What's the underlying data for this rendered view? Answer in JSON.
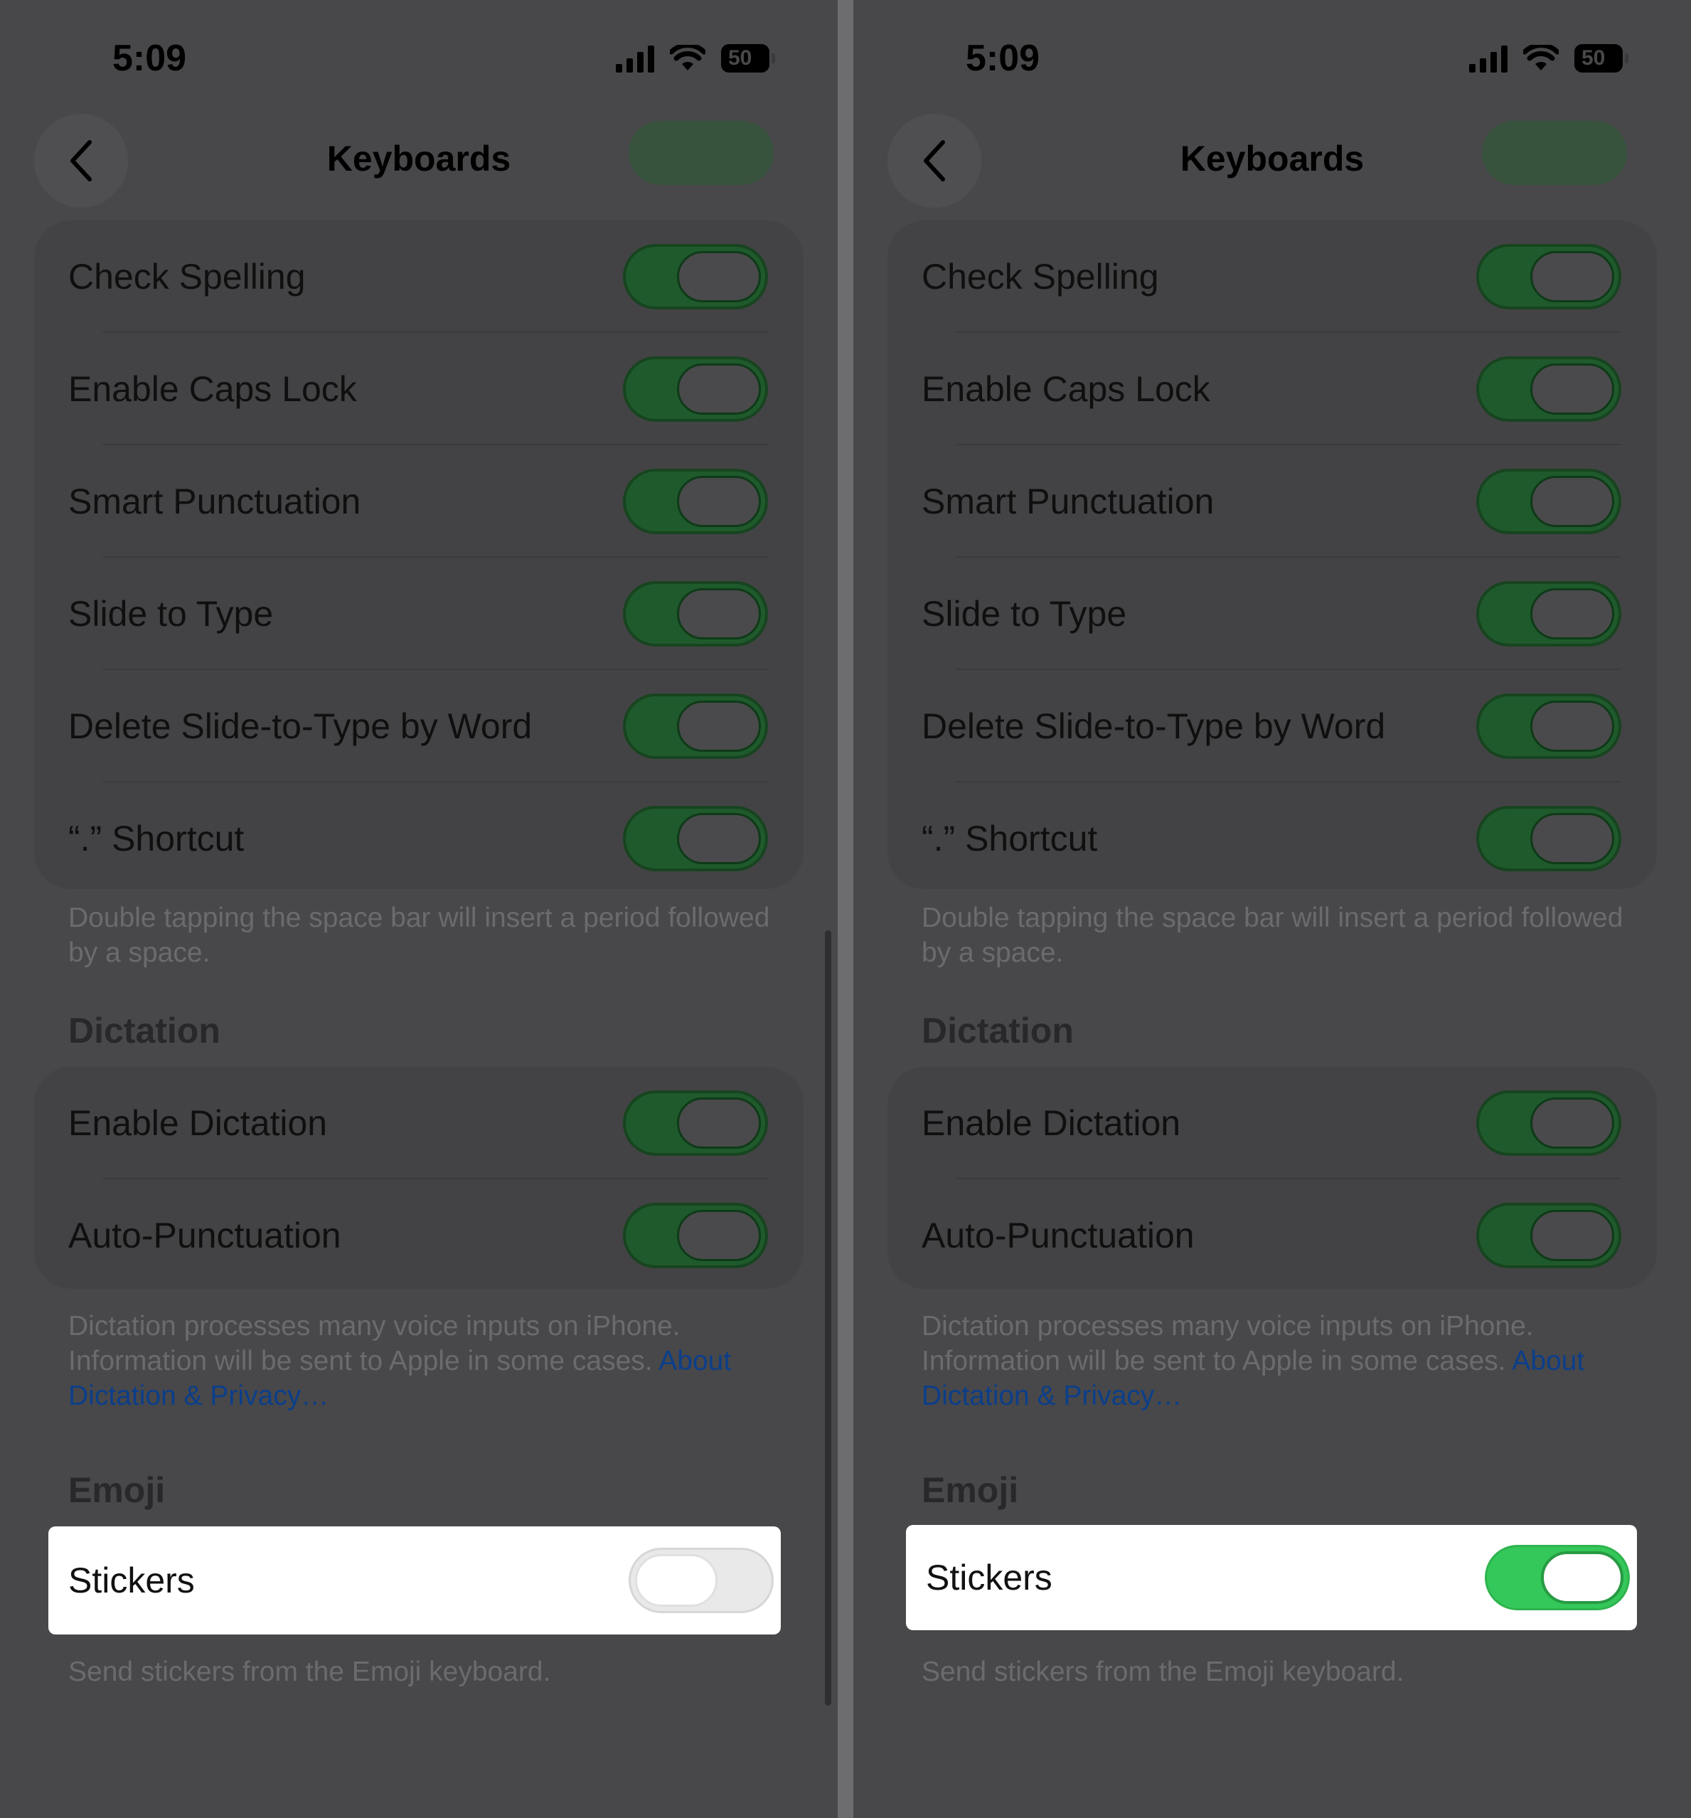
{
  "panels": [
    {
      "status": {
        "time": "5:09",
        "battery": "50"
      },
      "nav": {
        "title": "Keyboards"
      },
      "rows": [
        {
          "label": "Check Spelling",
          "on": true
        },
        {
          "label": "Enable Caps Lock",
          "on": true
        },
        {
          "label": "Smart Punctuation",
          "on": true
        },
        {
          "label": "Slide to Type",
          "on": true
        },
        {
          "label": "Delete Slide-to-Type by Word",
          "on": true
        },
        {
          "label": "“.” Shortcut",
          "on": true
        }
      ],
      "shortcut_footer": "Double tapping the space bar will insert a period followed by a space.",
      "dictation": {
        "header": "Dictation",
        "rows": [
          {
            "label": "Enable Dictation",
            "on": true
          },
          {
            "label": "Auto-Punctuation",
            "on": true
          }
        ],
        "footer_text": "Dictation processes many voice inputs on iPhone. Information will be sent to Apple in some cases. ",
        "footer_link": "About Dictation & Privacy…"
      },
      "emoji": {
        "header": "Emoji",
        "stickers_label": "Stickers",
        "stickers_on": false,
        "footer": "Send stickers from the Emoji keyboard."
      }
    },
    {
      "status": {
        "time": "5:09",
        "battery": "50"
      },
      "nav": {
        "title": "Keyboards"
      },
      "rows": [
        {
          "label": "Check Spelling",
          "on": true
        },
        {
          "label": "Enable Caps Lock",
          "on": true
        },
        {
          "label": "Smart Punctuation",
          "on": true
        },
        {
          "label": "Slide to Type",
          "on": true
        },
        {
          "label": "Delete Slide-to-Type by Word",
          "on": true
        },
        {
          "label": "“.” Shortcut",
          "on": true
        }
      ],
      "shortcut_footer": "Double tapping the space bar will insert a period followed by a space.",
      "dictation": {
        "header": "Dictation",
        "rows": [
          {
            "label": "Enable Dictation",
            "on": true
          },
          {
            "label": "Auto-Punctuation",
            "on": true
          }
        ],
        "footer_text": "Dictation processes many voice inputs on iPhone. Information will be sent to Apple in some cases. ",
        "footer_link": "About Dictation & Privacy…"
      },
      "emoji": {
        "header": "Emoji",
        "stickers_label": "Stickers",
        "stickers_on": true,
        "footer": "Send stickers from the Emoji keyboard."
      }
    }
  ]
}
